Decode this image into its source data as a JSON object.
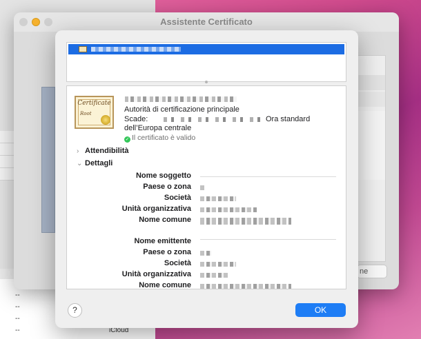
{
  "background_window": {
    "list_rows": [
      {
        "value": "--",
        "name": ""
      },
      {
        "value": "--",
        "name": ""
      },
      {
        "value": "--",
        "name": ""
      },
      {
        "value": "--",
        "name": "iCloud"
      }
    ]
  },
  "assistant_window": {
    "title": "Assistente Certificato",
    "partial_button_label": "ne"
  },
  "certificate_list": {
    "selected_item_name_redacted": true
  },
  "certificate": {
    "authority_type": "Autorità di certificazione principale",
    "expiry_label": "Scade:",
    "expiry_timezone_line1": "Ora standard",
    "expiry_timezone_line2": "dell’Europa centrale",
    "valid_icon": "checkmark-circle-icon",
    "valid_text": "Il certificato è valido",
    "image_word1": "Certificate",
    "image_word2": "Root"
  },
  "sections": {
    "trust": {
      "label": "Attendibilità",
      "expanded": false
    },
    "details": {
      "label": "Dettagli",
      "expanded": true
    }
  },
  "details": {
    "subject_header": "Nome soggetto",
    "subject_fields": [
      "Paese o zona",
      "Società",
      "Unità organizzativa",
      "Nome comune"
    ],
    "issuer_header": "Nome emittente",
    "issuer_fields": [
      "Paese o zona",
      "Società",
      "Unità organizzativa",
      "Nome comune"
    ]
  },
  "buttons": {
    "help_label": "?",
    "ok_label": "OK"
  },
  "colors": {
    "accent": "#1e7df5",
    "selection": "#1c6ce3",
    "valid_green": "#34c759",
    "desktop_pink": "#d24c8e"
  }
}
